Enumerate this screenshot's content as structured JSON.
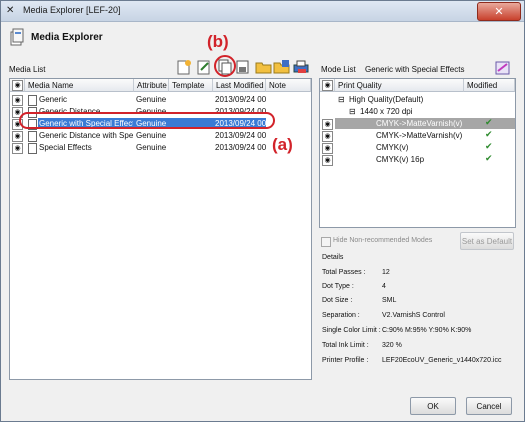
{
  "window": {
    "title": "Media Explorer [LEF-20]",
    "close_glyph": "✕"
  },
  "header": {
    "title": "Media Explorer"
  },
  "annotations": {
    "a": "(a)",
    "b": "(b)"
  },
  "media_list": {
    "label": "Media List",
    "columns": [
      "Media Name",
      "Attribute",
      "Template",
      "Last Modified",
      "Note"
    ],
    "rows": [
      {
        "name": "Generic",
        "attribute": "Genuine",
        "template": "",
        "modified": "2013/09/24 00:",
        "note": ""
      },
      {
        "name": "Generic Distance",
        "attribute": "Genuine",
        "template": "",
        "modified": "2013/09/24 00:",
        "note": ""
      },
      {
        "name": "Generic with Special Effect",
        "attribute": "Genuine",
        "template": "",
        "modified": "2013/09/24 00:",
        "note": "",
        "selected": true
      },
      {
        "name": "Generic Distance with Spec",
        "attribute": "Genuine",
        "template": "",
        "modified": "2013/09/24 00:",
        "note": ""
      },
      {
        "name": "Special Effects",
        "attribute": "Genuine",
        "template": "",
        "modified": "2013/09/24 00:",
        "note": ""
      }
    ]
  },
  "mode_list": {
    "label": "Mode List",
    "value": "Generic with Special Effects",
    "columns": [
      "Print Quality",
      "Modified"
    ],
    "rows": [
      {
        "text": "High Quality(Default)",
        "tree": "⊟",
        "modified": ""
      },
      {
        "text": "1440 x 720 dpi",
        "tree": "⊟",
        "modified": ""
      },
      {
        "text": "CMYK->MatteVarnish(v)",
        "modified": "✔",
        "selected": true
      },
      {
        "text": "CMYK->MatteVarnish(v)",
        "modified": "✔"
      },
      {
        "text": "CMYK(v)",
        "modified": "✔"
      },
      {
        "text": "CMYK(v) 16p",
        "modified": "✔"
      }
    ]
  },
  "options": {
    "hide_label": "Hide Non-recommended Modes",
    "set_default_label": "Set as Default"
  },
  "details": {
    "heading": "Details",
    "items": [
      {
        "label": "Total Passes :",
        "value": "12"
      },
      {
        "label": "Dot Type :",
        "value": "4"
      },
      {
        "label": "Dot Size :",
        "value": "SML"
      },
      {
        "label": "Separation :",
        "value": "V2.VarnishS Control"
      },
      {
        "label": "Single Color Limit :",
        "value": "C:90%  M:95%  Y:90%  K:90%"
      },
      {
        "label": "Total Ink Limit :",
        "value": "320 %"
      },
      {
        "label": "Printer Profile :",
        "value": "LEF20EcoUV_Generic_v1440x720.icc"
      }
    ]
  },
  "footer": {
    "ok_label": "OK",
    "cancel_label": "Cancel"
  },
  "colors": {
    "accent_selection": "#3a7bd5",
    "annotation_red": "#d2232a"
  },
  "icons": [
    "app-icon",
    "media-explorer-icon",
    "new-media-icon",
    "edit-media-icon",
    "copy-media-icon",
    "delete-media-icon",
    "open-folder-icon",
    "save-icon",
    "print-icon",
    "mode-settings-icon",
    "eye-icon",
    "document-icon",
    "check-icon"
  ]
}
